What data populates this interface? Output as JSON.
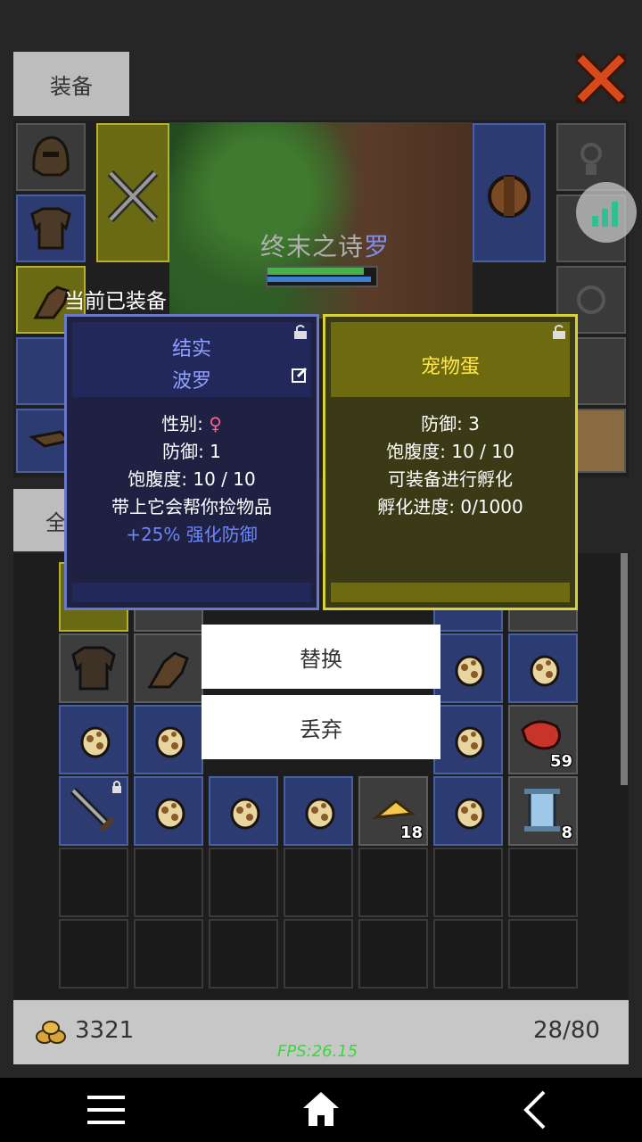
{
  "header": {
    "tab_label": "装备"
  },
  "player": {
    "name_main": "终末之诗",
    "name_suffix": "罗"
  },
  "equipped_label": "当前已装备",
  "cards": {
    "current": {
      "title_line1": "结实",
      "title_line2": "波罗",
      "stats": [
        "性别: ",
        "防御: 1",
        "饱腹度: 10 / 10",
        "带上它会帮你捡物品"
      ],
      "gender_symbol": "♀",
      "bonus": "+25% 强化防御",
      "colors": {
        "title": "#8fa0ff",
        "bonus": "#6b86ff",
        "gender": "#ff5f8a"
      }
    },
    "new": {
      "title": "宠物蛋",
      "stats": [
        "防御: 3",
        "饱腹度: 10 / 10",
        "可装备进行孵化",
        "孵化进度: 0/1000"
      ],
      "colors": {
        "title": "#ffe84a"
      }
    }
  },
  "popup": {
    "replace_label": "替换",
    "discard_label": "丢弃"
  },
  "filter_tab_label": "全",
  "inventory": {
    "quantities": {
      "meat": "59",
      "cheese": "18",
      "scroll": "8"
    }
  },
  "footer": {
    "gold": "3321",
    "capacity": "28/80",
    "fps": "FPS:26.15"
  },
  "nav": {
    "icons": [
      "menu-icon",
      "home-icon",
      "back-icon"
    ]
  }
}
